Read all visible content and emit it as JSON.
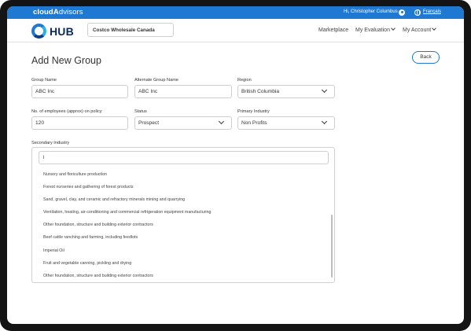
{
  "topbar": {
    "brand_bold": "cloud",
    "brand_light": "dvisors",
    "brand_a": "A",
    "greeting": "Hi, Christopher Columbus",
    "language": "Français",
    "colors": {
      "bar": "#1f78d1"
    }
  },
  "navbar": {
    "logo_text": "HUB",
    "company": "Costco Wholesale Canada",
    "links": [
      "Marketplace",
      "My Evaluation",
      "My Account"
    ]
  },
  "page": {
    "title": "Add New Group",
    "back_label": "Back"
  },
  "form": {
    "group_name": {
      "label": "Group Name",
      "value": "ABC Inc"
    },
    "alt_group_name": {
      "label": "Alternate Group Name",
      "value": "ABC Inc"
    },
    "region": {
      "label": "Region",
      "value": "British Columbia"
    },
    "employees": {
      "label": "No. of employees (approx) on policy",
      "value": "120"
    },
    "status": {
      "label": "Status",
      "value": "Prospect"
    },
    "primary_industry": {
      "label": "Primary Industry",
      "value": "Non Profits"
    },
    "secondary_industry": {
      "label": "Secondary Industry",
      "search_value": "l",
      "options": [
        "Nursery and floriculture production",
        "Forest nurseries and gathering of forest products",
        "Sand, gravel, clay, and ceramic and refractory minerals mining and quarrying",
        "Ventilation, heating, air-conditioning and commercial refrigeration equipment manufacturing",
        "Other foundation, structure and building exterior contractors",
        "Beef cattle ranching and farming, including feedlots",
        "Imperial Oil",
        "Fruit and vegetable canning, pickling and drying",
        "Other foundation, structure and building exterior contractors"
      ]
    }
  }
}
